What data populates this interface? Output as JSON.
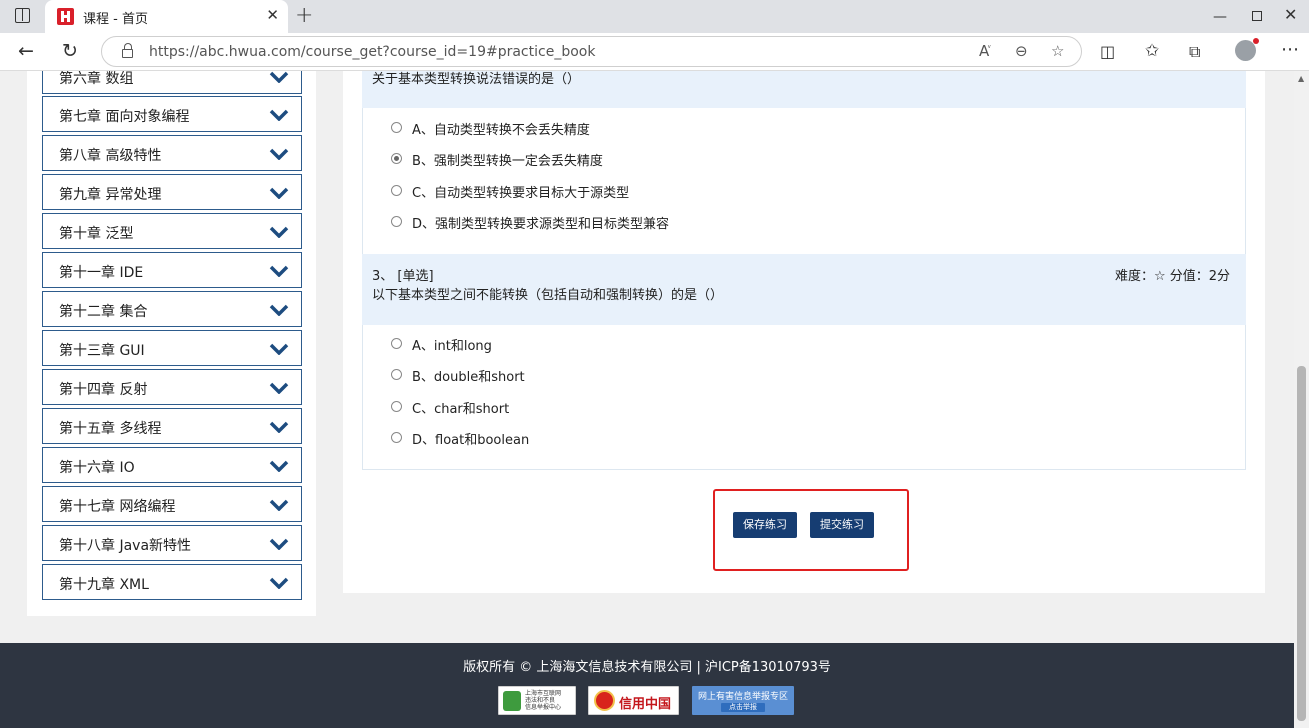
{
  "browser": {
    "tab_title": "课程 - 首页",
    "tab_close": "✕",
    "new_tab": "+",
    "url": "https://abc.hwua.com/course_get?course_id=19#practice_book",
    "window_controls": {
      "minimize": "—",
      "close": "✕"
    }
  },
  "sidebar": {
    "chapters": [
      "第六章 数组",
      "第七章 面向对象编程",
      "第八章 高级特性",
      "第九章 异常处理",
      "第十章 泛型",
      "第十一章 IDE",
      "第十二章 集合",
      "第十三章 GUI",
      "第十四章 反射",
      "第十五章 多线程",
      "第十六章 IO",
      "第十七章 网络编程",
      "第十八章 Java新特性",
      "第十九章 XML"
    ]
  },
  "questions": [
    {
      "text": "关于基本类型转换说法错误的是（）",
      "options": [
        {
          "label": "A、自动类型转换不会丢失精度",
          "selected": false
        },
        {
          "label": "B、强制类型转换一定会丢失精度",
          "selected": true
        },
        {
          "label": "C、自动类型转换要求目标大于源类型",
          "selected": false
        },
        {
          "label": "D、强制类型转换要求源类型和目标类型兼容",
          "selected": false
        }
      ]
    },
    {
      "number_type": "3、 [单选]",
      "meta": "难度：☆  分值：2分",
      "text": "以下基本类型之间不能转换（包括自动和强制转换）的是（）",
      "options": [
        {
          "label": "A、int和long",
          "selected": false
        },
        {
          "label": "B、double和short",
          "selected": false
        },
        {
          "label": "C、char和short",
          "selected": false
        },
        {
          "label": "D、float和boolean",
          "selected": false
        }
      ]
    }
  ],
  "actions": {
    "save_label": "保存练习",
    "submit_label": "提交练习"
  },
  "footer": {
    "copyright": "版权所有 © 上海海文信息技术有限公司 | 沪ICP备13010793号",
    "badge1_text": "上海市互联网\n违法和不良\n信息举报中心",
    "badge2_text": "信用中国",
    "badge3_top": "网上有害信息举报专区",
    "badge3_bottom": "点击举报"
  },
  "colors": {
    "primary_button": "#163d72",
    "highlight_border": "#e02020",
    "question_header_bg": "#e8f1fb",
    "footer_bg": "#2e3541",
    "chapter_border": "#2d5b8c"
  }
}
